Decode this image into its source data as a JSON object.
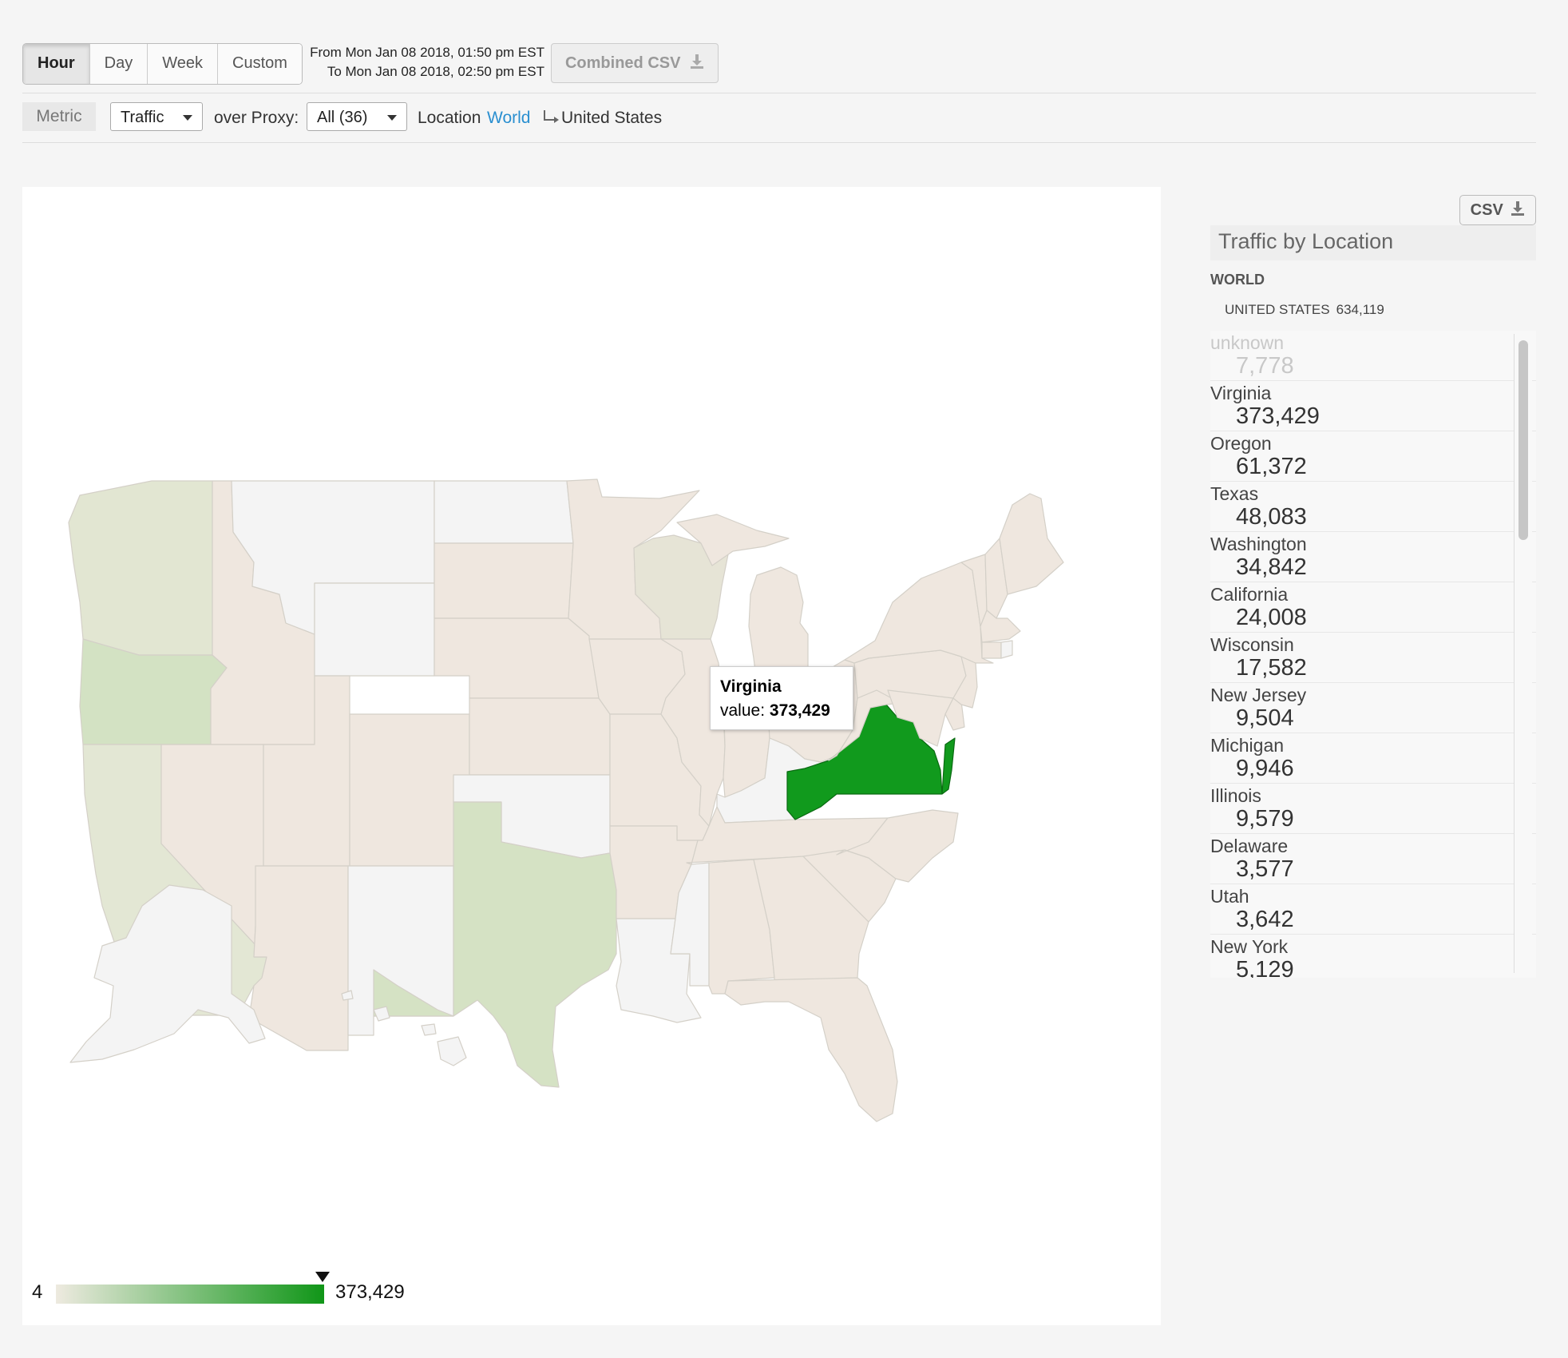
{
  "toolbar": {
    "range_buttons": [
      "Hour",
      "Day",
      "Week",
      "Custom"
    ],
    "active_range": "Hour",
    "from_text": "From Mon Jan 08 2018, 01:50 pm EST",
    "to_text": "To Mon Jan 08 2018, 02:50 pm EST",
    "combined_csv_label": "Combined CSV",
    "download_icon": "download-icon"
  },
  "filters": {
    "metric_label": "Metric",
    "metric_value": "Traffic",
    "over_proxy_label": "over Proxy:",
    "proxy_value": "All (36)",
    "location_label": "Location",
    "location_world_link": "World",
    "location_current": "United States",
    "breadcrumb_icon": "subdirectory-arrow-icon"
  },
  "map": {
    "tooltip": {
      "title": "Virginia",
      "value_label": "value:",
      "value": "373,429"
    },
    "legend": {
      "min": "4",
      "max": "373,429",
      "color_low": "#eeeae0",
      "color_high": "#109618",
      "marker_fraction": 1.0
    },
    "colors": {
      "no_data": "#f4f4f4",
      "low": "#efe7df",
      "wisconsin": "#e6e4d6",
      "washington": "#e2e6d2",
      "california": "#e3e7d4",
      "oregon": "#d3e2c3",
      "texas": "#d5e2c4",
      "virginia": "#119a1d",
      "border": "#d4d0c8",
      "virginia_border": "#0a6a12"
    }
  },
  "side": {
    "csv_label": "CSV",
    "title": "Traffic by Location",
    "world_label": "WORLD",
    "country_label": "UNITED STATES",
    "country_total": "634,119",
    "locations": [
      {
        "name": "unknown",
        "value": "7,778"
      },
      {
        "name": "Virginia",
        "value": "373,429"
      },
      {
        "name": "Oregon",
        "value": "61,372"
      },
      {
        "name": "Texas",
        "value": "48,083"
      },
      {
        "name": "Washington",
        "value": "34,842"
      },
      {
        "name": "California",
        "value": "24,008"
      },
      {
        "name": "Wisconsin",
        "value": "17,582"
      },
      {
        "name": "New Jersey",
        "value": "9,504"
      },
      {
        "name": "Michigan",
        "value": "9,946"
      },
      {
        "name": "Illinois",
        "value": "9,579"
      },
      {
        "name": "Delaware",
        "value": "3,577"
      },
      {
        "name": "Utah",
        "value": "3,642"
      },
      {
        "name": "New York",
        "value": "5,129"
      }
    ]
  }
}
